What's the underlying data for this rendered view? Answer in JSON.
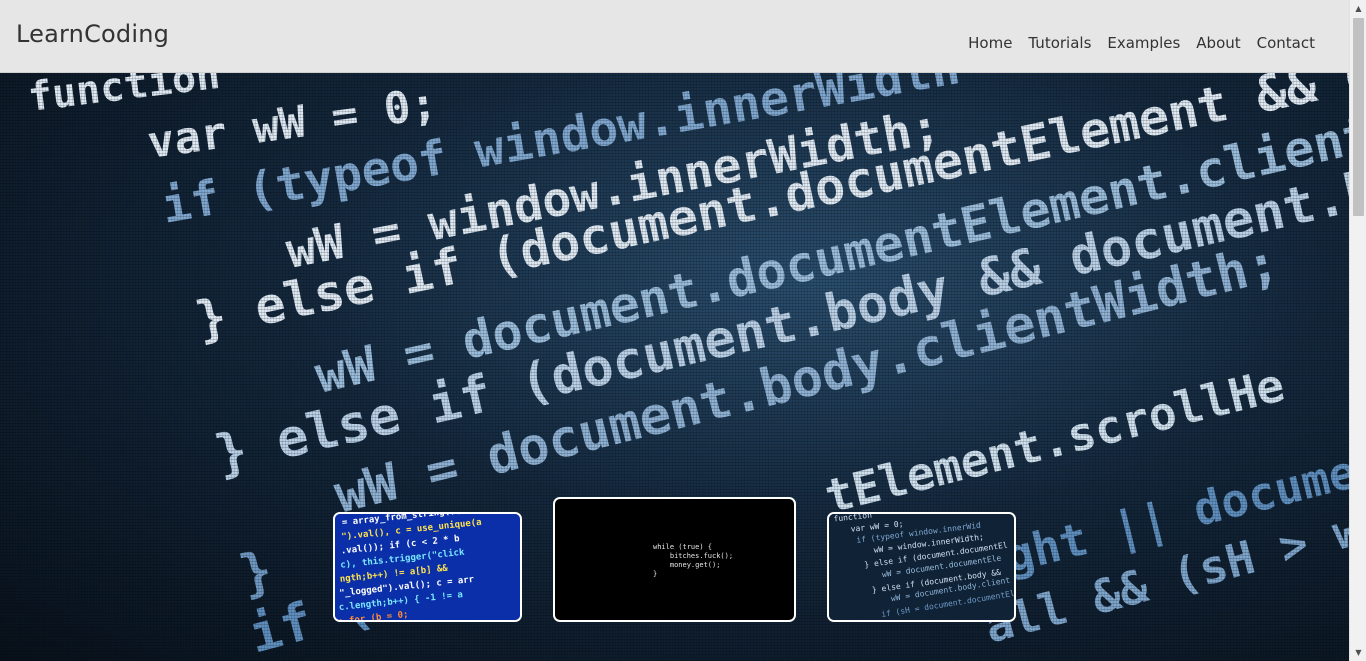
{
  "brand": "LearnCoding",
  "nav": [
    {
      "label": "Home"
    },
    {
      "label": "Tutorials"
    },
    {
      "label": "Examples"
    },
    {
      "label": "About"
    },
    {
      "label": "Contact"
    }
  ],
  "hero": {
    "code_lines": [
      "function",
      "var wW = 0;",
      "if (typeof window.innerWidth",
      "wW = window.innerWidth;",
      "} else if (document.documentElement && docum",
      "wW = document.documentElement.clientWidt",
      "} else if (document.body && document.body.c",
      "wW = document.body.clientWidth;",
      "}",
      "if (sH"
    ],
    "right_code": [
      "tElement.scrollHe",
      "ght || documen",
      "all && (sH > wH)"
    ]
  },
  "thumbnails": [
    {
      "name": "thumbnail-1",
      "theme": "blue-code"
    },
    {
      "name": "thumbnail-2",
      "theme": "black-terminal",
      "text": "while (true) {\n    bitches.fuck();\n    money.get();\n}"
    },
    {
      "name": "thumbnail-3",
      "theme": "dark-js-code"
    }
  ],
  "scrollbar": {
    "up_icon": "▲",
    "down_icon": "▼"
  },
  "colors": {
    "navbar_bg": "#e6e6e6",
    "nav_text": "#333333",
    "code_text": "#dfe9f3",
    "code_dim": "#5f8fbf"
  }
}
